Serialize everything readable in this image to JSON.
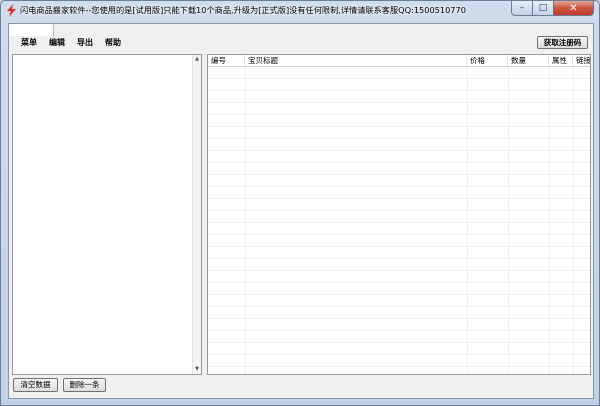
{
  "window": {
    "title": "闪电商品搬家软件--您使用的是[试用版]只能下载10个商品,升级为[正式版]没有任何限制,详情请联系客服QQ:1500510770",
    "controls": {
      "minimize": "–",
      "maximize": "□",
      "close": "✕"
    }
  },
  "menu": {
    "items": [
      "菜单",
      "编辑",
      "导出",
      "帮助"
    ]
  },
  "toolbar": {
    "get_registration_code": "获取注册码"
  },
  "grid": {
    "columns": [
      "编号",
      "宝贝标题",
      "价格",
      "数量",
      "属性",
      "链接"
    ],
    "rows": []
  },
  "buttons": {
    "clear_data": "清空数据",
    "delete_one": "删除一条"
  },
  "icons": {
    "app": "lightning-icon",
    "scroll_up": "scroll-up-icon",
    "scroll_down": "scroll-down-icon"
  },
  "colors": {
    "accent_red": "#e0301e",
    "close_button": "#c9563f"
  }
}
